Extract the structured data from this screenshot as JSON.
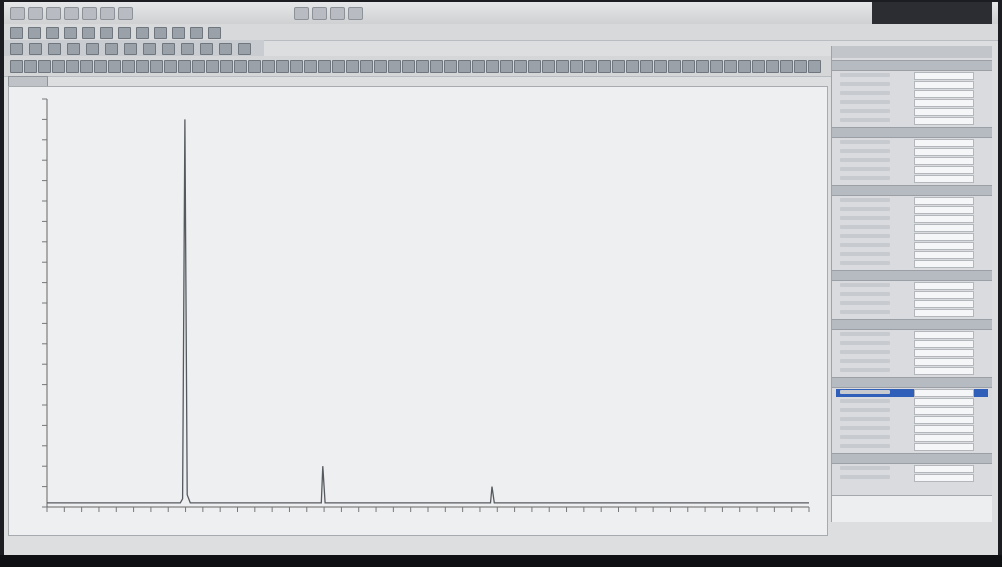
{
  "colors": {
    "screen_bg": "#dcdedf",
    "plot_bg": "#eeeff0",
    "trace": "#555a60",
    "selection": "#2f5fb8"
  },
  "window": {
    "title_icons": [
      "file-icon",
      "save-icon",
      "print-icon",
      "undo-icon",
      "redo-icon",
      "zoom-icon",
      "settings-icon"
    ]
  },
  "top_right": {
    "label_1": "",
    "label_2": ""
  },
  "doc_tab": {
    "label": ""
  },
  "toolbar_icon_count": 60,
  "chart_data": {
    "type": "line",
    "title": "",
    "xlabel": "",
    "ylabel": "",
    "ylim": [
      0,
      1
    ],
    "xlim": [
      0,
      1
    ],
    "grid": false,
    "series": [
      {
        "points": [
          [
            0.0,
            0.01
          ],
          [
            0.175,
            0.01
          ],
          [
            0.178,
            0.02
          ],
          [
            0.181,
            0.95
          ],
          [
            0.184,
            0.03
          ],
          [
            0.188,
            0.01
          ],
          [
            0.36,
            0.01
          ],
          [
            0.362,
            0.1
          ],
          [
            0.365,
            0.01
          ],
          [
            0.53,
            0.01
          ],
          [
            0.582,
            0.01
          ],
          [
            0.584,
            0.05
          ],
          [
            0.587,
            0.01
          ],
          [
            1.0,
            0.01
          ]
        ]
      }
    ]
  },
  "properties_panel": {
    "title": "",
    "sections": [
      {
        "header": "",
        "rows": 6
      },
      {
        "header": "",
        "rows": 5
      },
      {
        "header": "",
        "rows": 8
      },
      {
        "header": "",
        "rows": 4
      },
      {
        "header": "",
        "rows": 5
      },
      {
        "header": "",
        "rows": 7,
        "selected_row": 0
      },
      {
        "header": "",
        "rows": 2
      }
    ],
    "description": ""
  },
  "status_bar": {
    "text": ""
  },
  "clock": {
    "time": ""
  }
}
